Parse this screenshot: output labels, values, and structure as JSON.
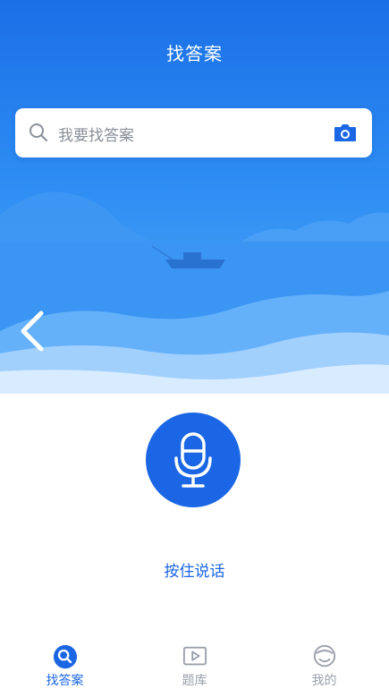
{
  "header": {
    "title": "找答案"
  },
  "search": {
    "placeholder": "我要找答案"
  },
  "voice": {
    "hint": "按住说话"
  },
  "tabs": [
    {
      "label": "找答案",
      "icon": "search-tab-icon",
      "active": true
    },
    {
      "label": "题库",
      "icon": "play-tab-icon",
      "active": false
    },
    {
      "label": "我的",
      "icon": "profile-tab-icon",
      "active": false
    }
  ],
  "colors": {
    "primary": "#1b66e4",
    "inactive": "#9aa0aa"
  }
}
